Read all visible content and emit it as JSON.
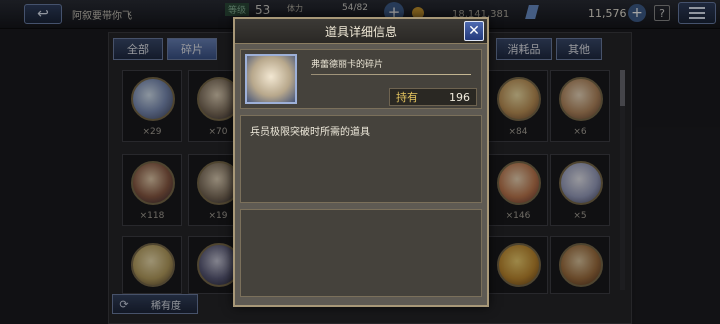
{
  "topbar": {
    "player_name": "阿叙要带你飞",
    "level_label": "等级",
    "level": "53",
    "stamina_label": "体力",
    "stamina": "54/82",
    "gold": "18,141,381",
    "crystals": "11,576"
  },
  "tabs": [
    {
      "label": "全部"
    },
    {
      "label": "碎片"
    },
    {
      "label": "消耗品"
    },
    {
      "label": "其他"
    }
  ],
  "grid": {
    "counts": [
      "×29",
      "×70",
      "×84",
      "×6",
      "×118",
      "×19",
      "×146",
      "×5"
    ]
  },
  "sort_button": {
    "label": "稀有度"
  },
  "modal": {
    "title": "道具详细信息",
    "item_name": "弗蕾德丽卡的碎片",
    "own_label": "持有",
    "own_count": "196",
    "description": "兵员极限突破时所需的道具"
  },
  "colors": {
    "accent_blue": "#3a5288",
    "gold_text": "#e4c45f",
    "panel_brown": "#45423c"
  }
}
